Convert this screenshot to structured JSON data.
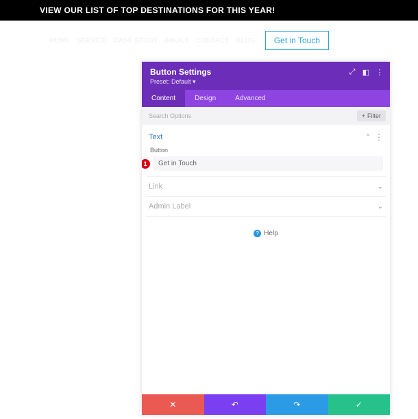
{
  "banner": {
    "text": "VIEW OUR LIST OF TOP DESTINATIONS FOR THIS YEAR!"
  },
  "nav": {
    "links": [
      "HOME",
      "SERVICE",
      "CASE STUDY",
      "ABOUT",
      "CONTACT",
      "BLOG"
    ],
    "cta": "Get in Touch"
  },
  "panel": {
    "title": "Button Settings",
    "preset": "Preset: Default",
    "tabs": [
      "Content",
      "Design",
      "Advanced"
    ],
    "active_tab": 0,
    "search_placeholder": "Search Options",
    "filter_label": "Filter",
    "sections": {
      "text": {
        "title": "Text",
        "expanded": true,
        "field_label": "Button",
        "field_value": "Get in Touch",
        "badge": "1"
      },
      "link": {
        "title": "Link"
      },
      "admin": {
        "title": "Admin Label"
      }
    },
    "help": "Help"
  }
}
